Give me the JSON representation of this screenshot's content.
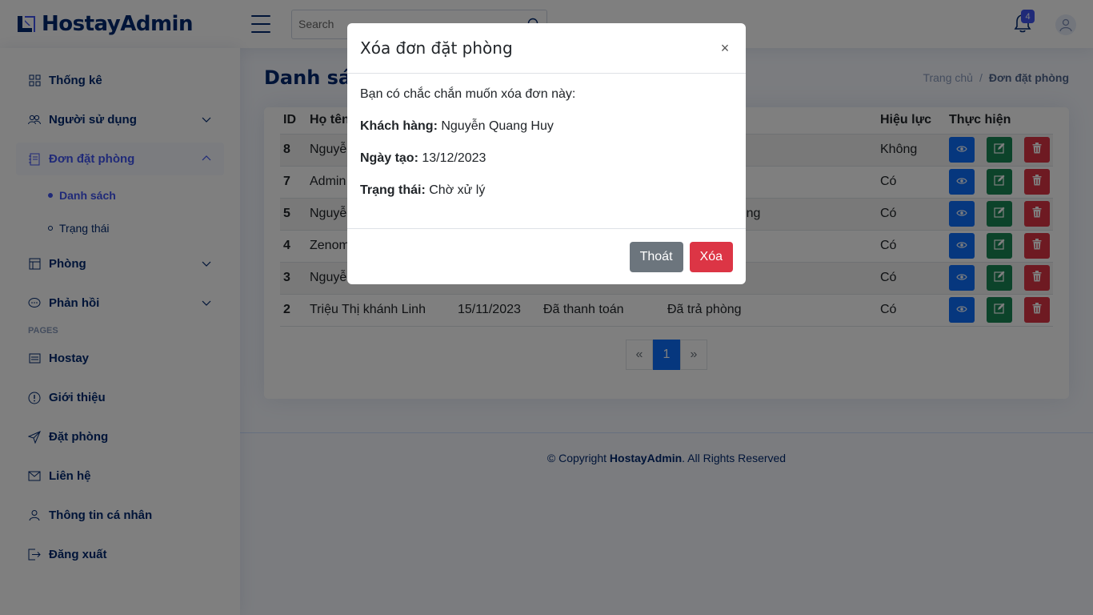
{
  "header": {
    "app_name": "HostayAdmin",
    "search_placeholder": "Search",
    "notification_count": "4"
  },
  "sidebar": {
    "items": [
      {
        "label": "Thống kê",
        "icon": "grid-icon"
      },
      {
        "label": "Người sử dụng",
        "icon": "people-icon"
      },
      {
        "label": "Đơn đặt phòng",
        "icon": "journal-icon"
      },
      {
        "label": "Phòng",
        "icon": "layout-icon"
      },
      {
        "label": "Phản hồi",
        "icon": "chat-icon"
      }
    ],
    "subitems": [
      {
        "label": "Danh sách"
      },
      {
        "label": "Trạng thái"
      }
    ],
    "pages_heading": "PAGES",
    "pages": [
      {
        "label": "Hostay",
        "icon": "card-icon"
      },
      {
        "label": "Giới thiệu",
        "icon": "info-icon"
      },
      {
        "label": "Đặt phòng",
        "icon": "send-icon"
      },
      {
        "label": "Liên hệ",
        "icon": "envelope-icon"
      },
      {
        "label": "Thông tin cá nhân",
        "icon": "person-icon"
      },
      {
        "label": "Đăng xuất",
        "icon": "logout-icon"
      }
    ]
  },
  "main": {
    "title": "Danh sách",
    "breadcrumb": {
      "home": "Trang chủ",
      "separator": "/",
      "current": "Đơn đặt phòng"
    },
    "table": {
      "headers": [
        "ID",
        "Họ tên",
        "",
        "",
        "",
        "Hiệu lực",
        "Thực hiện"
      ],
      "rows": [
        {
          "id": "8",
          "name": "Nguyễn Quang Huy",
          "date": "",
          "payment": "",
          "status": "",
          "valid": "Không"
        },
        {
          "id": "7",
          "name": "Admin",
          "date": "",
          "payment": "",
          "status": "",
          "valid": "Có"
        },
        {
          "id": "5",
          "name": "Nguyễn",
          "date": "",
          "payment": "",
          "status": "chờ nhận phòng",
          "valid": "Có"
        },
        {
          "id": "4",
          "name": "Zenom",
          "date": "",
          "payment": "",
          "status": "",
          "valid": "Có"
        },
        {
          "id": "3",
          "name": "Nguyễn",
          "date": "",
          "payment": "",
          "status": "",
          "valid": "Có"
        },
        {
          "id": "2",
          "name": "Triệu Thị khánh Linh",
          "date": "15/11/2023",
          "payment": "Đã thanh toán",
          "status": "Đã trả phòng",
          "valid": "Có"
        }
      ]
    },
    "pagination": {
      "prev": "«",
      "current": "1",
      "next": "»"
    }
  },
  "footer": {
    "prefix": "© Copyright",
    "brand": "HostayAdmin",
    "suffix": ". All Rights Reserved"
  },
  "modal": {
    "title": "Xóa đơn đặt phòng",
    "close": "×",
    "question": "Bạn có chắc chắn muốn xóa đơn này:",
    "customer_label": "Khách hàng:",
    "customer_value": "Nguyễn Quang Huy",
    "created_label": "Ngày tạo:",
    "created_value": "13/12/2023",
    "status_label": "Trạng thái:",
    "status_value": "Chờ xử lý",
    "cancel_button": "Thoát",
    "delete_button": "Xóa"
  },
  "colors": {
    "primary": "#4154f1",
    "navy": "#012970",
    "view": "#0d6efd",
    "edit": "#198754",
    "delete": "#dc3545"
  }
}
